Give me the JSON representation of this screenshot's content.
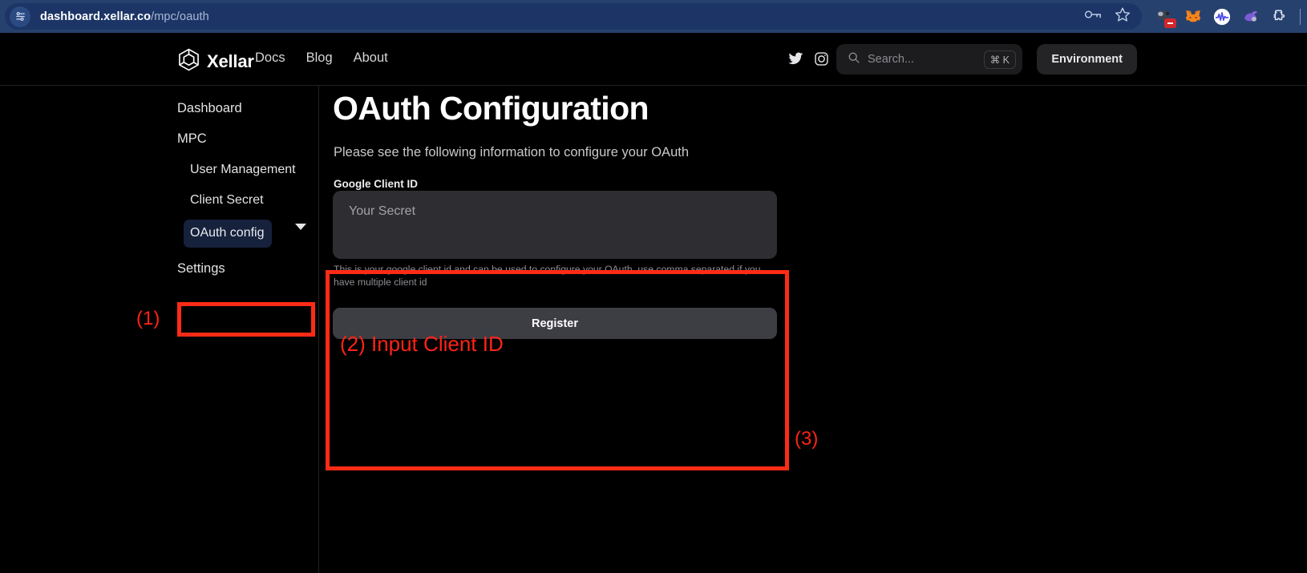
{
  "browser": {
    "url_host": "dashboard.xellar.co",
    "url_path": "/mpc/oauth",
    "site_info_icon": "site-settings-icon",
    "password_icon": "key-icon",
    "bookmark_icon": "star-icon",
    "extensions": [
      {
        "name": "extension-icon-blocked",
        "badge": "—"
      },
      {
        "name": "metamask-extension-icon"
      },
      {
        "name": "waveform-extension-icon"
      },
      {
        "name": "rabby-extension-icon"
      },
      {
        "name": "extensions-puzzle-icon"
      }
    ]
  },
  "topnav": {
    "logo_icon": "xellar-cube-logo-icon",
    "brand": "Xellar",
    "links": [
      "Docs",
      "Blog",
      "About"
    ],
    "social": [
      "twitter-icon",
      "instagram-icon"
    ],
    "search": {
      "icon": "search-icon",
      "placeholder": "Search...",
      "shortcut": "⌘ K"
    },
    "environment_button": "Environment"
  },
  "sidebar": {
    "items": [
      {
        "label": "Dashboard",
        "level": 0,
        "active": false
      },
      {
        "label": "MPC",
        "level": 0,
        "active": false,
        "expandable": true
      },
      {
        "label": "User Management",
        "level": 1,
        "active": false
      },
      {
        "label": "Client Secret",
        "level": 1,
        "active": false
      },
      {
        "label": "OAuth config",
        "level": 1,
        "active": true
      },
      {
        "label": "Settings",
        "level": 0,
        "active": false
      }
    ],
    "caret_icon": "chevron-down-icon"
  },
  "main": {
    "title": "OAuth Configuration",
    "subtitle": "Please see the following information to configure your OAuth",
    "field": {
      "label": "Google Client ID",
      "placeholder": "Your Secret",
      "value": "",
      "helper": "This is your google client id and can be used to configure your OAuth, use comma separated if you have multiple client id"
    },
    "register_button": "Register"
  },
  "annotations": {
    "color": "#ff2316",
    "step1": "(1)",
    "step2": "(2) Input Client ID",
    "step3": "(3)"
  }
}
